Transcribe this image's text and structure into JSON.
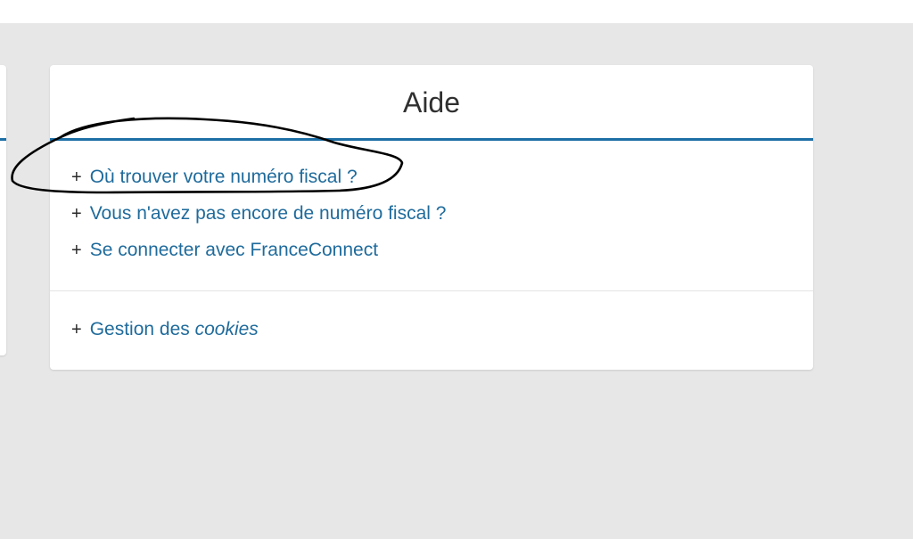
{
  "help": {
    "title": "Aide",
    "items": [
      {
        "icon": "plus-icon",
        "plus": "+",
        "label": "Où trouver votre numéro fiscal ?"
      },
      {
        "icon": "plus-icon",
        "plus": "+",
        "label": "Vous n'avez pas encore de numéro fiscal ?"
      },
      {
        "icon": "plus-icon",
        "plus": "+",
        "label": "Se connecter avec FranceConnect"
      }
    ],
    "cookies": {
      "icon": "plus-icon",
      "plus": "+",
      "label_prefix": "Gestion des ",
      "label_emphasis": "cookies"
    }
  },
  "colors": {
    "accent": "#1d6fa5",
    "link": "#1f6b9c",
    "page_background": "#e7e7e7",
    "card_background": "#ffffff",
    "annotation_stroke": "#000000"
  }
}
